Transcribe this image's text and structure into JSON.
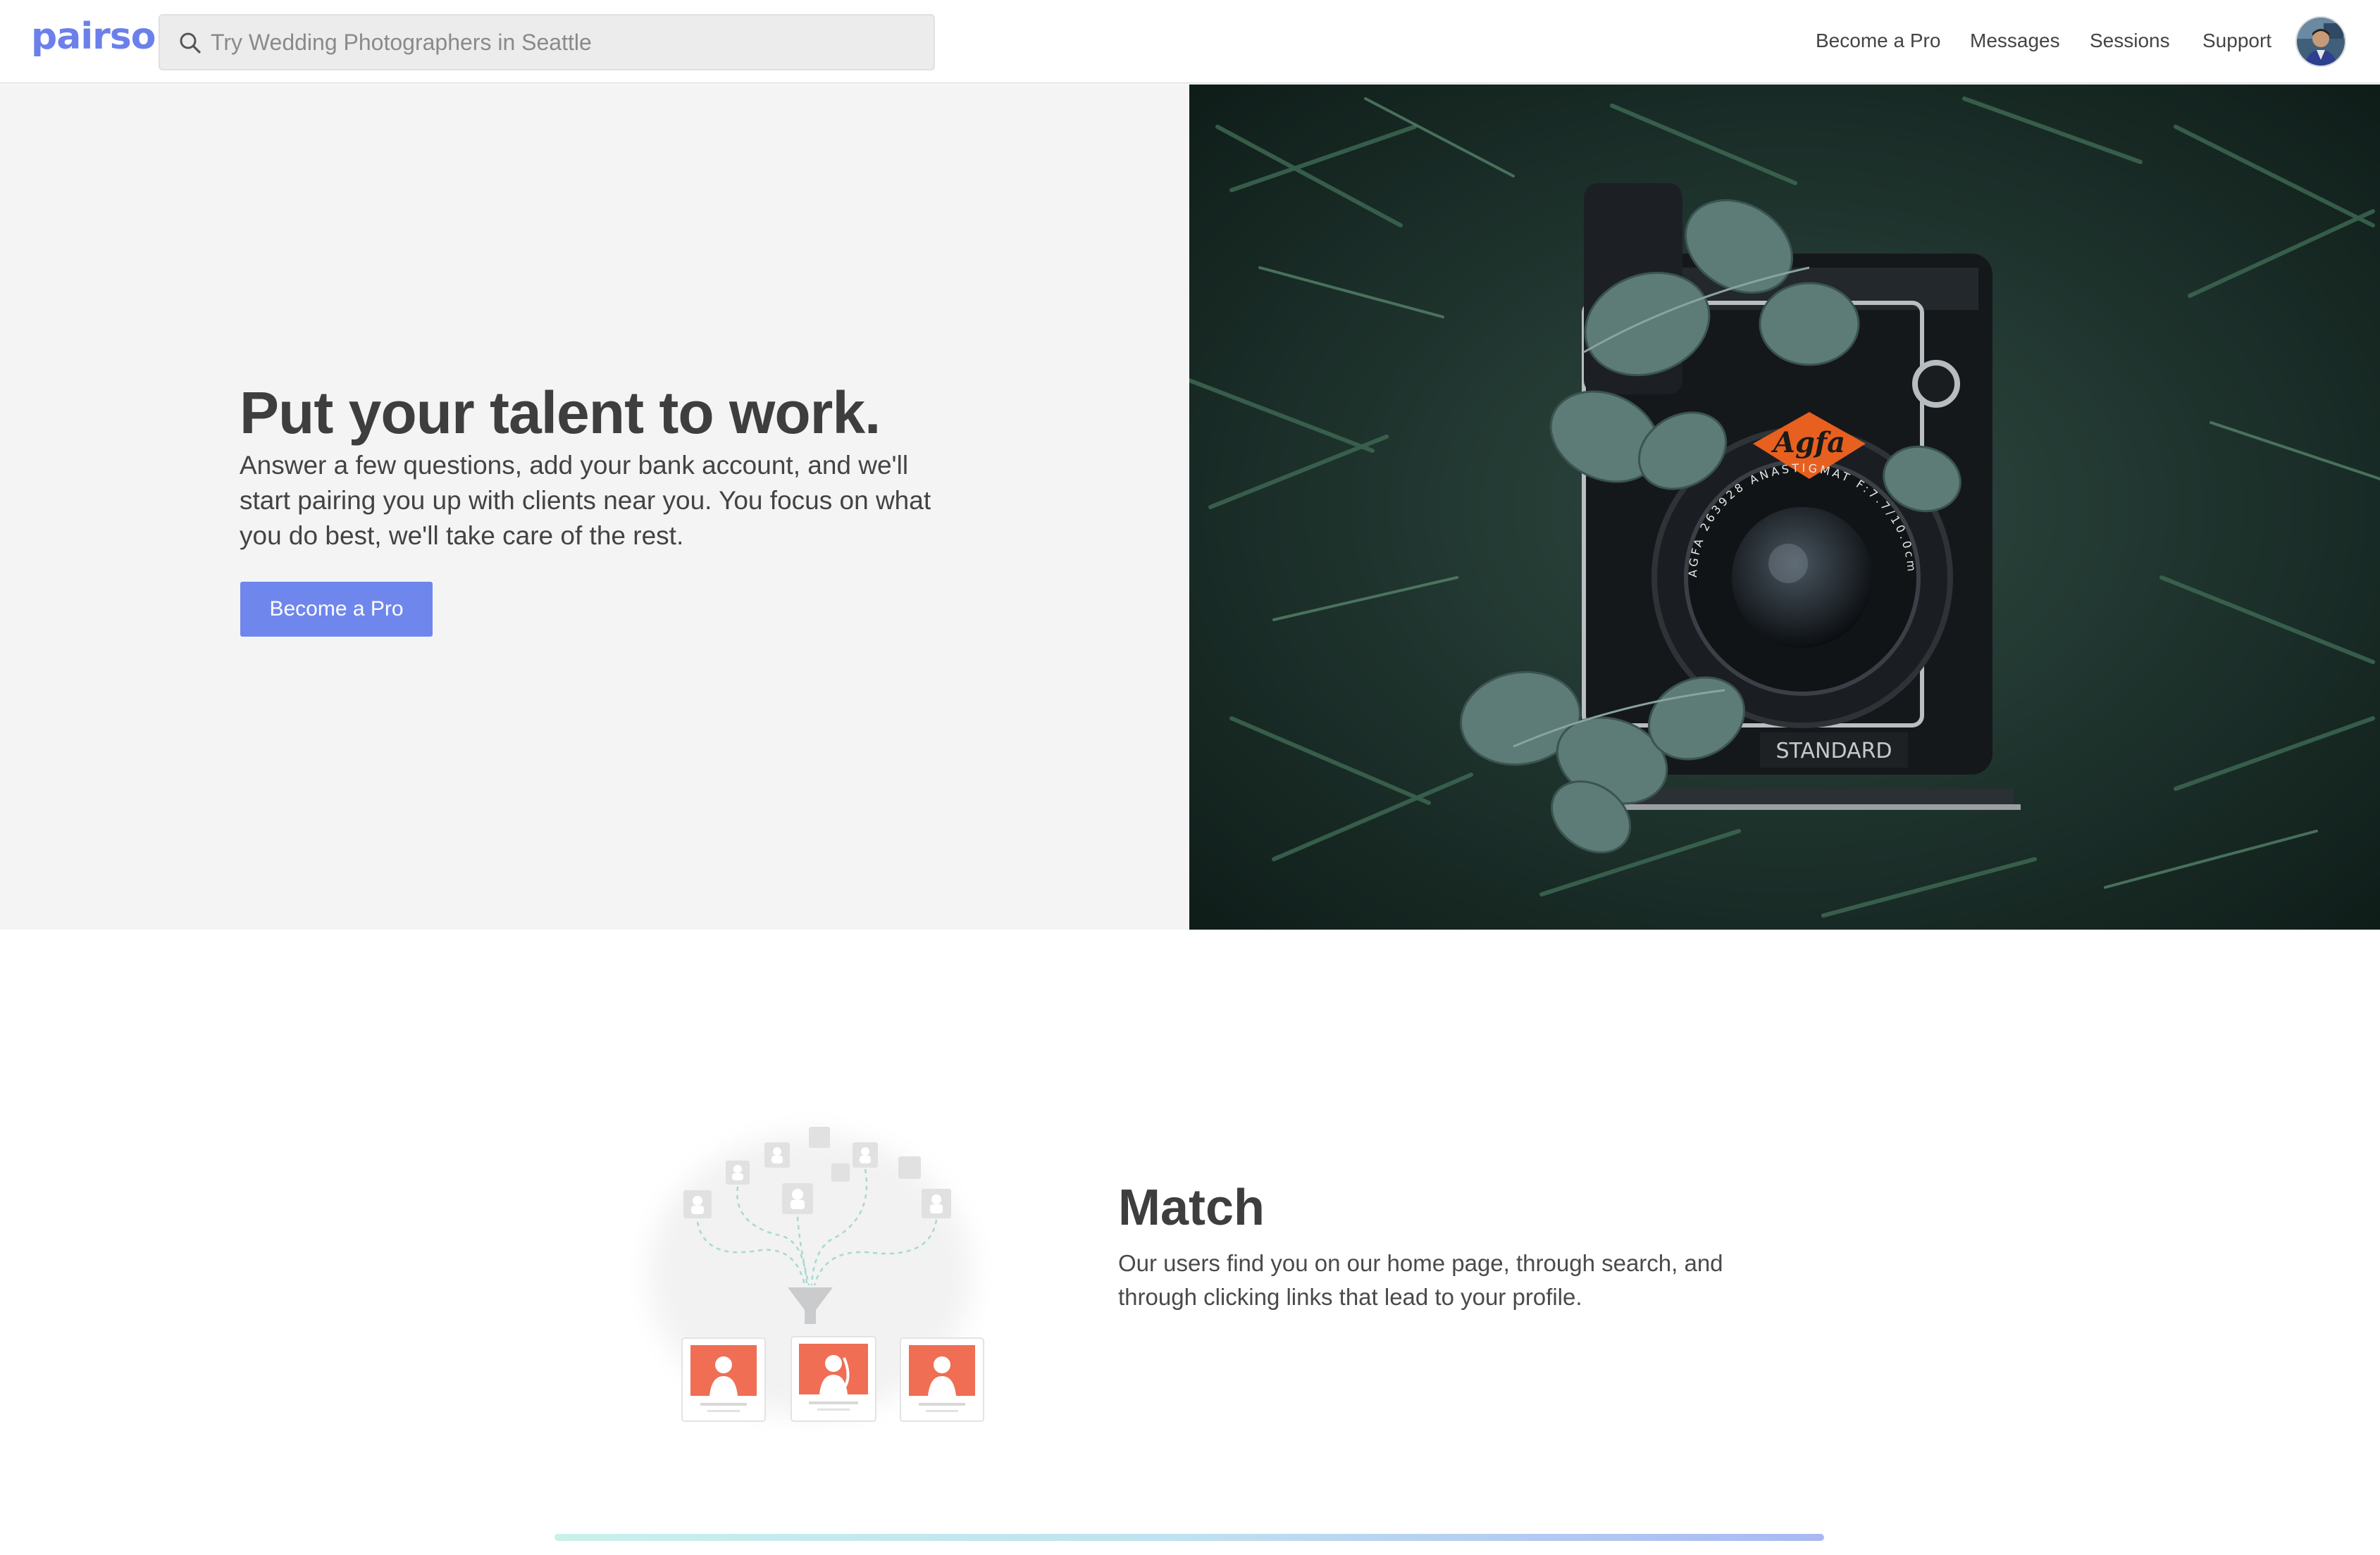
{
  "header": {
    "logo": "pairso",
    "search_placeholder": "Try Wedding Photographers in Seattle",
    "nav": [
      "Become a Pro",
      "Messages",
      "Sessions",
      "Support"
    ]
  },
  "hero": {
    "title": "Put your talent to work.",
    "description": "Answer a few questions, add your bank account, and we'll start pairing you up with clients near you. You focus on what you do best, we'll take care of the rest.",
    "cta": "Become a Pro",
    "image_text": {
      "badge": "Agfa",
      "lens_ring": "AGFA 263928 ANASTIGMAT F:7.7/10.0cm",
      "plate": "STANDARD"
    }
  },
  "match": {
    "title": "Match",
    "description": "Our users find you on our home page, through search, and through clicking links that lead to your profile."
  },
  "colors": {
    "accent": "#6f86ec",
    "logo": "#6b80ea",
    "profile_card": "#ef6e54"
  }
}
